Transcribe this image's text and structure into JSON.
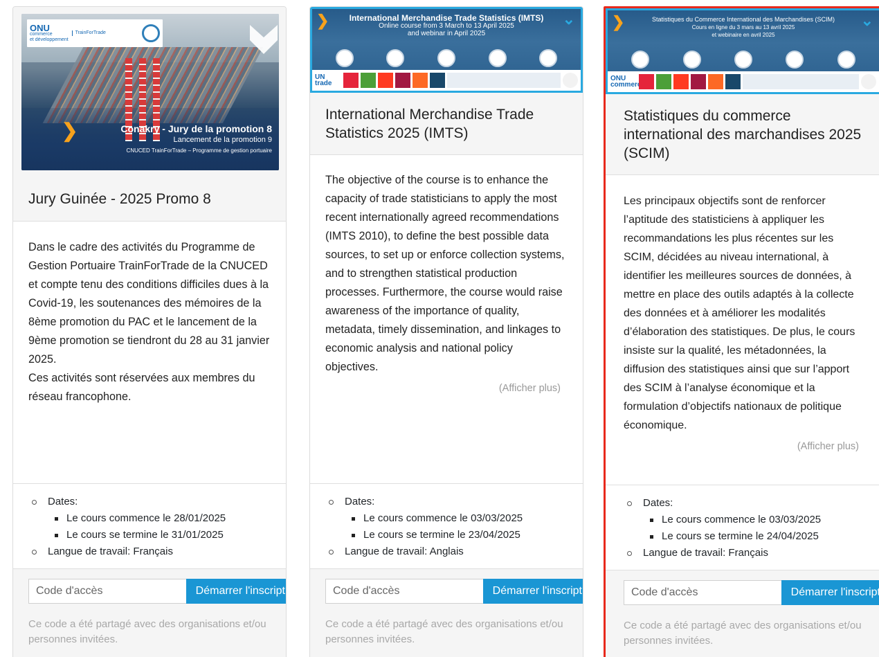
{
  "cards": [
    {
      "title": "Jury Guinée - 2025 Promo 8",
      "image": {
        "org_logo": "ONU",
        "org_sub1": "commerce",
        "org_sub2": "et développement",
        "program_logo": "TrainForTrade",
        "headline": "Conakry - Jury de la promotion 8",
        "subline": "Lancement de la promotion 9",
        "caption": "CNUCED TrainForTrade – Programme de gestion portuaire"
      },
      "description": "Dans le cadre des activités du Programme de Gestion Portuaire TrainForTrade de la CNUCED et compte tenu des conditions difficiles dues à la Covid-19, les soutenances des mémoires de la 8ème promotion du PAC et le lancement de la 9ème promotion se tiendront du 28 au 31 janvier 2025.\nCes activités sont réservées aux membres du réseau francophone.",
      "show_more": "",
      "dates_label": "Dates:",
      "start": "Le cours commence le 28/01/2025",
      "end": "Le cours se termine le 31/01/2025",
      "language": "Langue de travail: Français",
      "code_placeholder": "Code d'accès",
      "button": "Démarrer l'inscription",
      "note": "Ce code a été partagé avec des organisations et/ou personnes invitées."
    },
    {
      "title": "International Merchandise Trade Statistics 2025 (IMTS)",
      "image": {
        "line1": "International Merchandise Trade Statistics (IMTS)",
        "line2": "Online course from 3 March to 13 April 2025",
        "line3": "and webinar in April 2025",
        "org_logo": "UN trade"
      },
      "description": "The objective of the course is to enhance the capacity of trade statisticians to apply the most recent internationally agreed recommendations (IMTS 2010), to define the best possible data sources, to set up or enforce collection systems, and to strengthen statistical production processes. Furthermore, the course would raise awareness of the importance of quality, metadata, timely dissemination, and linkages to economic analysis and national policy objectives.",
      "show_more": "(Afficher plus)",
      "dates_label": "Dates:",
      "start": "Le cours commence le 03/03/2025",
      "end": "Le cours se termine le 23/04/2025",
      "language": "Langue de travail: Anglais",
      "code_placeholder": "Code d'accès",
      "button": "Démarrer l'inscription",
      "note": "Ce code a été partagé avec des organisations et/ou personnes invitées."
    },
    {
      "title": "Statistiques du commerce international des marchandises 2025 (SCIM)",
      "image": {
        "line1": "Statistiques du Commerce International des Marchandises (SCIM)",
        "line2": "Cours en ligne du 3 mars au 13 avril 2025",
        "line3": "et webinaire en avril 2025",
        "org_logo": "ONU commerce"
      },
      "description": "Les principaux objectifs sont de renforcer l’aptitude des statisticiens à appliquer les recommandations les plus récentes sur les SCIM, décidées au niveau international, à identifier les meilleures sources de données, à mettre en place des outils adaptés à la collecte des données et à améliorer les modalités d’élaboration des statistiques. De plus, le cours insiste sur la qualité, les métadonnées, la diffusion des statistiques ainsi que sur l’apport des SCIM à l’analyse économique et la formulation d’objectifs nationaux de politique économique.",
      "show_more": "(Afficher plus)",
      "dates_label": "Dates:",
      "start": "Le cours commence le 03/03/2025",
      "end": "Le cours se termine le 24/04/2025",
      "language": "Langue de travail: Français",
      "code_placeholder": "Code d'accès",
      "button": "Démarrer l'inscription",
      "note": "Ce code a été partagé avec des organisations et/ou personnes invitées."
    }
  ],
  "colors": {
    "accent": "#1a96d4",
    "selected_border": "#e8291c",
    "arrow": "#f7a21c"
  }
}
